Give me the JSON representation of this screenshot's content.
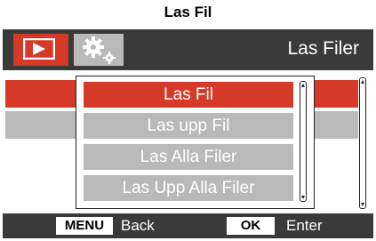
{
  "caption": "Las Fil",
  "header": {
    "title": "Las Filer",
    "tabs": [
      {
        "icon": "playback-icon",
        "active": true
      },
      {
        "icon": "settings-gears-icon",
        "active": false
      }
    ]
  },
  "popup": {
    "items": [
      {
        "label": "Las Fil",
        "selected": true
      },
      {
        "label": "Las upp Fil",
        "selected": false
      },
      {
        "label": "Las Alla Filer",
        "selected": false
      },
      {
        "label": "Las Upp Alla Filer",
        "selected": false
      }
    ]
  },
  "footer": {
    "menu_key": "MENU",
    "menu_action": "Back",
    "ok_key": "OK",
    "ok_action": "Enter"
  },
  "colors": {
    "accent": "#d43a27",
    "inactive": "#b9b9b9",
    "bar": "#3a3a3a"
  }
}
